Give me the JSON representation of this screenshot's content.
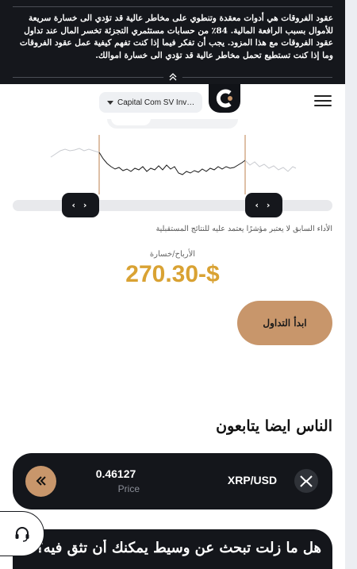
{
  "risk_banner": {
    "text": "عقود الفروقات هي أدوات معقدة وتنطوي على مخاطر عالية قد تؤدي الى خسارة سريعة للأموال بسبب الرافعة المالية. 84٪ من حسابات مستثمري التجزئة تخسر المال عند تداول عقود الفروقات مع هذا المزود. يجب أن تفكر فيما إذا كنت تفهم كيفية عمل عقود الفروقات وما إذا كنت تستطيع تحمل مخاطر عالية قد تؤدي الى خسارة اموالك.",
    "collapse_icon": "double-chevron-up-icon"
  },
  "header": {
    "product_select": "Capital Com SV Investments Limited",
    "logo_icon": "capital-com-logo-icon",
    "menu_icon": "hamburger-menu-icon"
  },
  "chart": {
    "left_handle": "‹ ›",
    "right_handle": "‹ ›",
    "past_performance_note": "الأداء السابق لا يعتبر مؤشرًا يعتمد عليه للنتائج المستقبلية",
    "accent_color": "#c8966b"
  },
  "pnl": {
    "label": "الأرباح/خسارة",
    "value": "270.30-$",
    "color": "#d9a233"
  },
  "cta": {
    "start_trading": "ابدأ التداول"
  },
  "section": {
    "title": "الناس ايضا يتابعون"
  },
  "instrument_card": {
    "symbol": "XRP/USD",
    "price": "0.46127",
    "price_label": "Price",
    "swap_icon": "double-chevron-left-icon",
    "coin_icon": "xrp-coin-icon"
  },
  "support": {
    "icon": "headset-support-icon"
  },
  "bottom_banner": {
    "text": "هل ما زلت تبحث عن وسيط يمكنك أن تثق فيه؟"
  }
}
